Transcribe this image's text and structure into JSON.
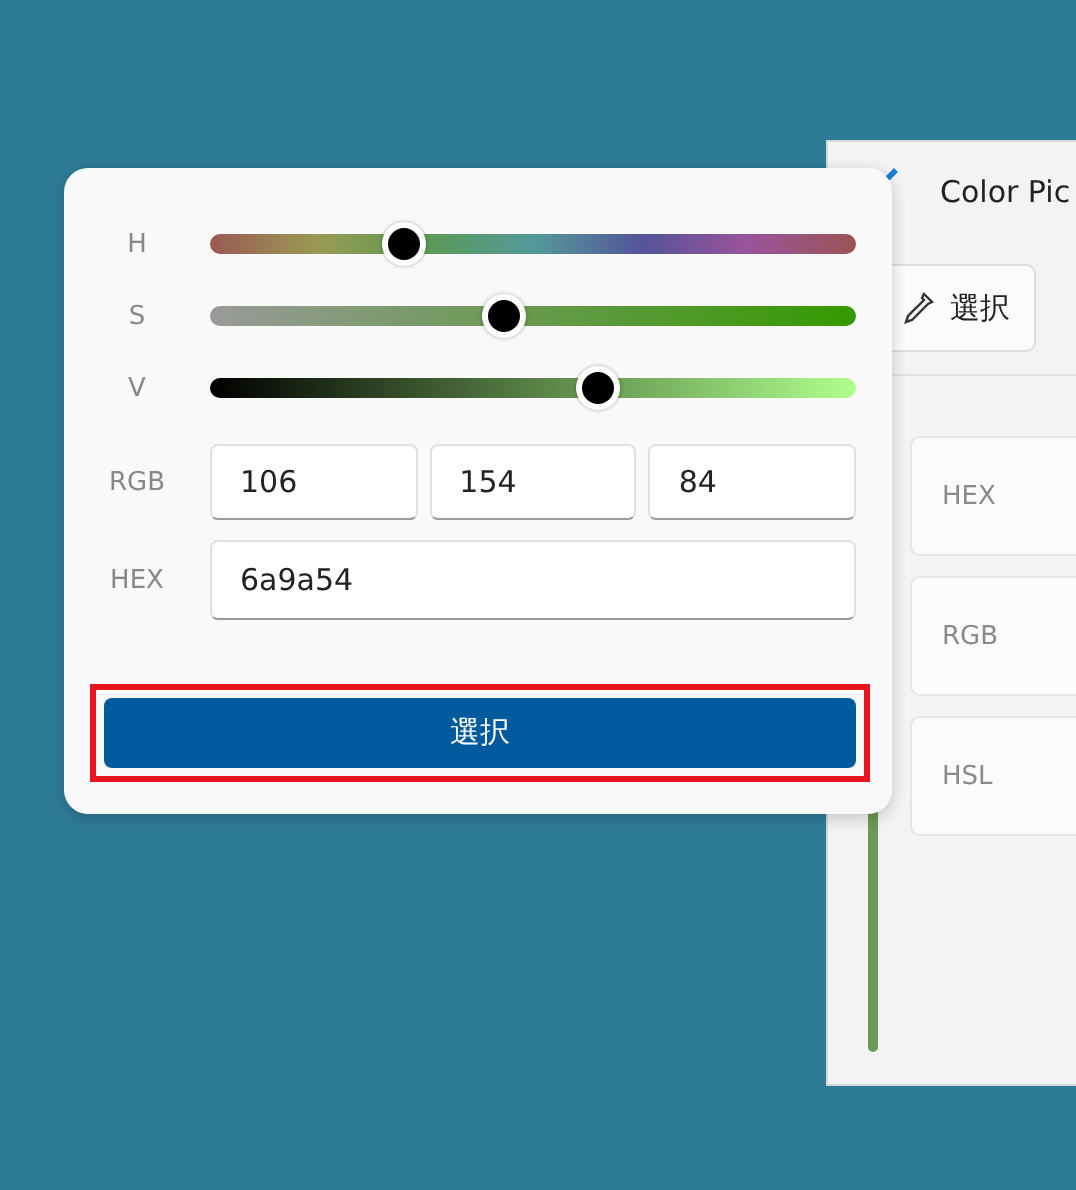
{
  "back_window": {
    "title": "Color Pic",
    "pick_button": "選択",
    "fields": [
      {
        "label": "HEX"
      },
      {
        "label": "RGB"
      },
      {
        "label": "HSL"
      }
    ]
  },
  "popup": {
    "sliders": [
      {
        "label": "H",
        "kind": "hue",
        "level": 0.3
      },
      {
        "label": "S",
        "kind": "saturation",
        "level": 0.455
      },
      {
        "label": "V",
        "kind": "value",
        "level": 0.6
      }
    ],
    "rgb": {
      "label": "RGB",
      "values": [
        "106",
        "154",
        "84"
      ]
    },
    "hex": {
      "label": "HEX",
      "value": "6a9a54"
    },
    "select_button": {
      "label": "選択",
      "highlighted": true
    }
  }
}
